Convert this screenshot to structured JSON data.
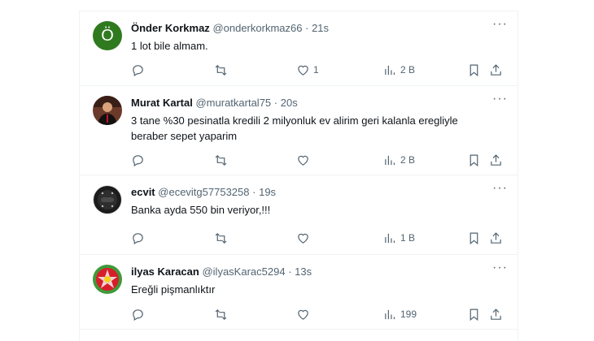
{
  "tweets": [
    {
      "name": "Önder Korkmaz",
      "handle": "@onderkorkmaz66",
      "time": "21s",
      "avatar_letter": "Ö",
      "text": "1 lot bile almam.",
      "likes": "1",
      "views": "2 B"
    },
    {
      "name": "Murat Kartal",
      "handle": "@muratkartal75",
      "time": "20s",
      "text": "3 tane %30 pesinatla kredili 2 milyonluk ev alirim geri kalanla eregliyle beraber sepet yaparim",
      "views": "2 B"
    },
    {
      "name": "ecvit",
      "handle": "@ecevitg57753258",
      "time": "19s",
      "text": "Banka ayda 550 bin veriyor,!!!",
      "views": "1 B"
    },
    {
      "name": "ilyas Karacan",
      "handle": "@ilyasKarac5294",
      "time": "13s",
      "text": "Ereğli pişmanlıktır",
      "views": "199"
    }
  ],
  "separator": "·",
  "more_glyph": "···",
  "colors": {
    "secondary_text": "#536471",
    "divider": "#eff3f4",
    "primary_text": "#0f1419"
  }
}
